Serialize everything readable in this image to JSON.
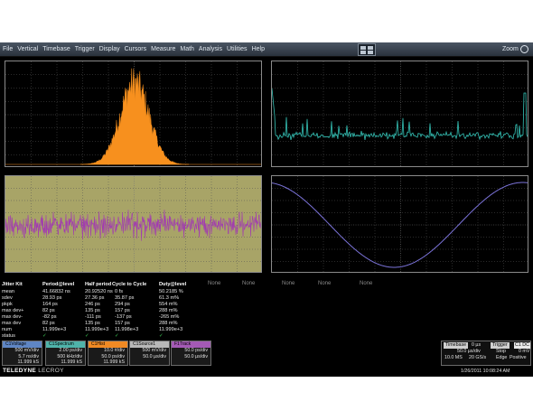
{
  "menu": {
    "items": [
      "File",
      "Vertical",
      "Timebase",
      "Trigger",
      "Display",
      "Cursors",
      "Measure",
      "Math",
      "Analysis",
      "Utilities",
      "Help"
    ],
    "zoom_label": "Zoom"
  },
  "colors": {
    "histogram": "#f7901e",
    "spectrum": "#35c2b6",
    "jitter_track": "#a23bb0",
    "track_background": "#a8a467",
    "sine": "#7b73d9"
  },
  "none_labels": [
    "None",
    "None",
    "None",
    "None",
    "None"
  ],
  "jitter_kit": {
    "title": "Jitter Kit",
    "columns": [
      "Period@level",
      "Half period",
      "Cycle to Cycle",
      "Duty@level"
    ],
    "rows": [
      {
        "label": "mean",
        "values": [
          "41.66832 ns",
          "20.92520 ns",
          "0 fs",
          "50.2185 %"
        ]
      },
      {
        "label": "sdev",
        "values": [
          "28.93 ps",
          "27.36 ps",
          "35.87 ps",
          "61.3 m%"
        ]
      },
      {
        "label": "pkpk",
        "values": [
          "164 ps",
          "246 ps",
          "294 ps",
          "554 m%"
        ]
      },
      {
        "label": "max dev+",
        "values": [
          "82 ps",
          "135 ps",
          "157 ps",
          "288 m%"
        ]
      },
      {
        "label": "max dev-",
        "values": [
          "-82 ps",
          "-111 ps",
          "-137 ps",
          "-265 m%"
        ]
      },
      {
        "label": "max dev",
        "values": [
          "82 ps",
          "135 ps",
          "157 ps",
          "288 m%"
        ]
      },
      {
        "label": "num",
        "values": [
          "11.999e+3",
          "11.999e+3",
          "11.998e+3",
          "11.999e+3"
        ]
      },
      {
        "label": "status",
        "values": [
          "✓",
          "✓",
          "✓",
          "✓"
        ]
      }
    ]
  },
  "descriptors": [
    {
      "name": "C1Voltage",
      "color": "#5f86c4",
      "lines": [
        "500 mV/div",
        "5.7 ns/div",
        "11.999 kS"
      ]
    },
    {
      "name": "C1Spectrum",
      "color": "#4fb3aa",
      "lines": [
        "2.00 ps/div",
        "500 kHz/div",
        "11.999 kS"
      ]
    },
    {
      "name": "C1Hist",
      "color": "#f08a24",
      "lines": [
        "10.0 #/div",
        "50.0 ps/div",
        "11.999 kS"
      ]
    },
    {
      "name": "C1Source1",
      "color": "#b8b8b8",
      "lines": [
        "500 mV/div",
        "50.0 µs/div",
        ""
      ]
    },
    {
      "name": "F1Track",
      "color": "#a45ab5",
      "lines": [
        "50.0 ps/div",
        "50.0 µs/div",
        ""
      ]
    }
  ],
  "timebase": {
    "label": "Timebase",
    "delay": "0 µs",
    "per_div": "50.0 µs/div",
    "samples": "10.0 MS",
    "rate": "20 GS/s",
    "trigger_label": "Trigger",
    "trigger_ch": "C1 DC",
    "mode": "Stop",
    "level": "0 mV",
    "type": "Edge",
    "slope": "Positive"
  },
  "brand": {
    "name": "TELEDYNE",
    "sub": "LECROY"
  },
  "datetime": "1/26/2011 10:08:24 AM"
}
